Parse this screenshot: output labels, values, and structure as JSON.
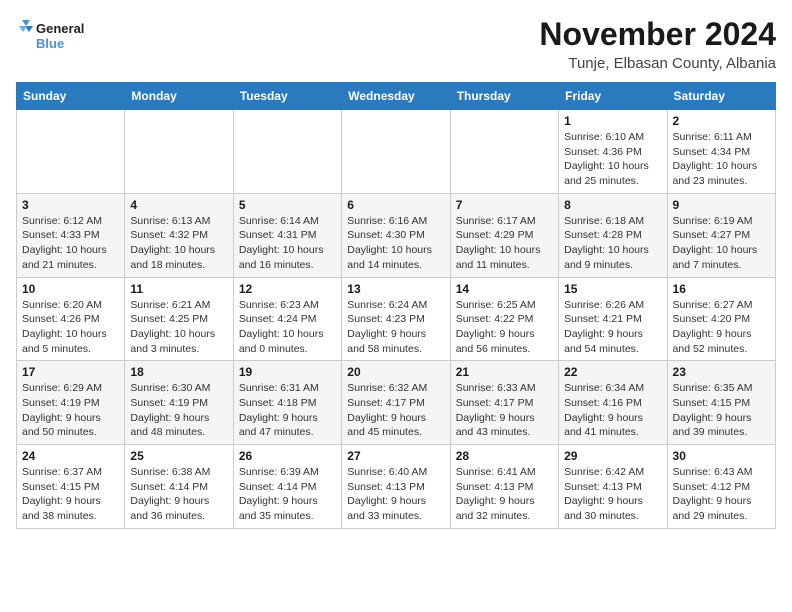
{
  "logo": {
    "line1": "General",
    "line2": "Blue"
  },
  "title": "November 2024",
  "location": "Tunje, Elbasan County, Albania",
  "days_of_week": [
    "Sunday",
    "Monday",
    "Tuesday",
    "Wednesday",
    "Thursday",
    "Friday",
    "Saturday"
  ],
  "weeks": [
    [
      {
        "day": "",
        "info": ""
      },
      {
        "day": "",
        "info": ""
      },
      {
        "day": "",
        "info": ""
      },
      {
        "day": "",
        "info": ""
      },
      {
        "day": "",
        "info": ""
      },
      {
        "day": "1",
        "info": "Sunrise: 6:10 AM\nSunset: 4:36 PM\nDaylight: 10 hours and 25 minutes."
      },
      {
        "day": "2",
        "info": "Sunrise: 6:11 AM\nSunset: 4:34 PM\nDaylight: 10 hours and 23 minutes."
      }
    ],
    [
      {
        "day": "3",
        "info": "Sunrise: 6:12 AM\nSunset: 4:33 PM\nDaylight: 10 hours and 21 minutes."
      },
      {
        "day": "4",
        "info": "Sunrise: 6:13 AM\nSunset: 4:32 PM\nDaylight: 10 hours and 18 minutes."
      },
      {
        "day": "5",
        "info": "Sunrise: 6:14 AM\nSunset: 4:31 PM\nDaylight: 10 hours and 16 minutes."
      },
      {
        "day": "6",
        "info": "Sunrise: 6:16 AM\nSunset: 4:30 PM\nDaylight: 10 hours and 14 minutes."
      },
      {
        "day": "7",
        "info": "Sunrise: 6:17 AM\nSunset: 4:29 PM\nDaylight: 10 hours and 11 minutes."
      },
      {
        "day": "8",
        "info": "Sunrise: 6:18 AM\nSunset: 4:28 PM\nDaylight: 10 hours and 9 minutes."
      },
      {
        "day": "9",
        "info": "Sunrise: 6:19 AM\nSunset: 4:27 PM\nDaylight: 10 hours and 7 minutes."
      }
    ],
    [
      {
        "day": "10",
        "info": "Sunrise: 6:20 AM\nSunset: 4:26 PM\nDaylight: 10 hours and 5 minutes."
      },
      {
        "day": "11",
        "info": "Sunrise: 6:21 AM\nSunset: 4:25 PM\nDaylight: 10 hours and 3 minutes."
      },
      {
        "day": "12",
        "info": "Sunrise: 6:23 AM\nSunset: 4:24 PM\nDaylight: 10 hours and 0 minutes."
      },
      {
        "day": "13",
        "info": "Sunrise: 6:24 AM\nSunset: 4:23 PM\nDaylight: 9 hours and 58 minutes."
      },
      {
        "day": "14",
        "info": "Sunrise: 6:25 AM\nSunset: 4:22 PM\nDaylight: 9 hours and 56 minutes."
      },
      {
        "day": "15",
        "info": "Sunrise: 6:26 AM\nSunset: 4:21 PM\nDaylight: 9 hours and 54 minutes."
      },
      {
        "day": "16",
        "info": "Sunrise: 6:27 AM\nSunset: 4:20 PM\nDaylight: 9 hours and 52 minutes."
      }
    ],
    [
      {
        "day": "17",
        "info": "Sunrise: 6:29 AM\nSunset: 4:19 PM\nDaylight: 9 hours and 50 minutes."
      },
      {
        "day": "18",
        "info": "Sunrise: 6:30 AM\nSunset: 4:19 PM\nDaylight: 9 hours and 48 minutes."
      },
      {
        "day": "19",
        "info": "Sunrise: 6:31 AM\nSunset: 4:18 PM\nDaylight: 9 hours and 47 minutes."
      },
      {
        "day": "20",
        "info": "Sunrise: 6:32 AM\nSunset: 4:17 PM\nDaylight: 9 hours and 45 minutes."
      },
      {
        "day": "21",
        "info": "Sunrise: 6:33 AM\nSunset: 4:17 PM\nDaylight: 9 hours and 43 minutes."
      },
      {
        "day": "22",
        "info": "Sunrise: 6:34 AM\nSunset: 4:16 PM\nDaylight: 9 hours and 41 minutes."
      },
      {
        "day": "23",
        "info": "Sunrise: 6:35 AM\nSunset: 4:15 PM\nDaylight: 9 hours and 39 minutes."
      }
    ],
    [
      {
        "day": "24",
        "info": "Sunrise: 6:37 AM\nSunset: 4:15 PM\nDaylight: 9 hours and 38 minutes."
      },
      {
        "day": "25",
        "info": "Sunrise: 6:38 AM\nSunset: 4:14 PM\nDaylight: 9 hours and 36 minutes."
      },
      {
        "day": "26",
        "info": "Sunrise: 6:39 AM\nSunset: 4:14 PM\nDaylight: 9 hours and 35 minutes."
      },
      {
        "day": "27",
        "info": "Sunrise: 6:40 AM\nSunset: 4:13 PM\nDaylight: 9 hours and 33 minutes."
      },
      {
        "day": "28",
        "info": "Sunrise: 6:41 AM\nSunset: 4:13 PM\nDaylight: 9 hours and 32 minutes."
      },
      {
        "day": "29",
        "info": "Sunrise: 6:42 AM\nSunset: 4:13 PM\nDaylight: 9 hours and 30 minutes."
      },
      {
        "day": "30",
        "info": "Sunrise: 6:43 AM\nSunset: 4:12 PM\nDaylight: 9 hours and 29 minutes."
      }
    ]
  ]
}
